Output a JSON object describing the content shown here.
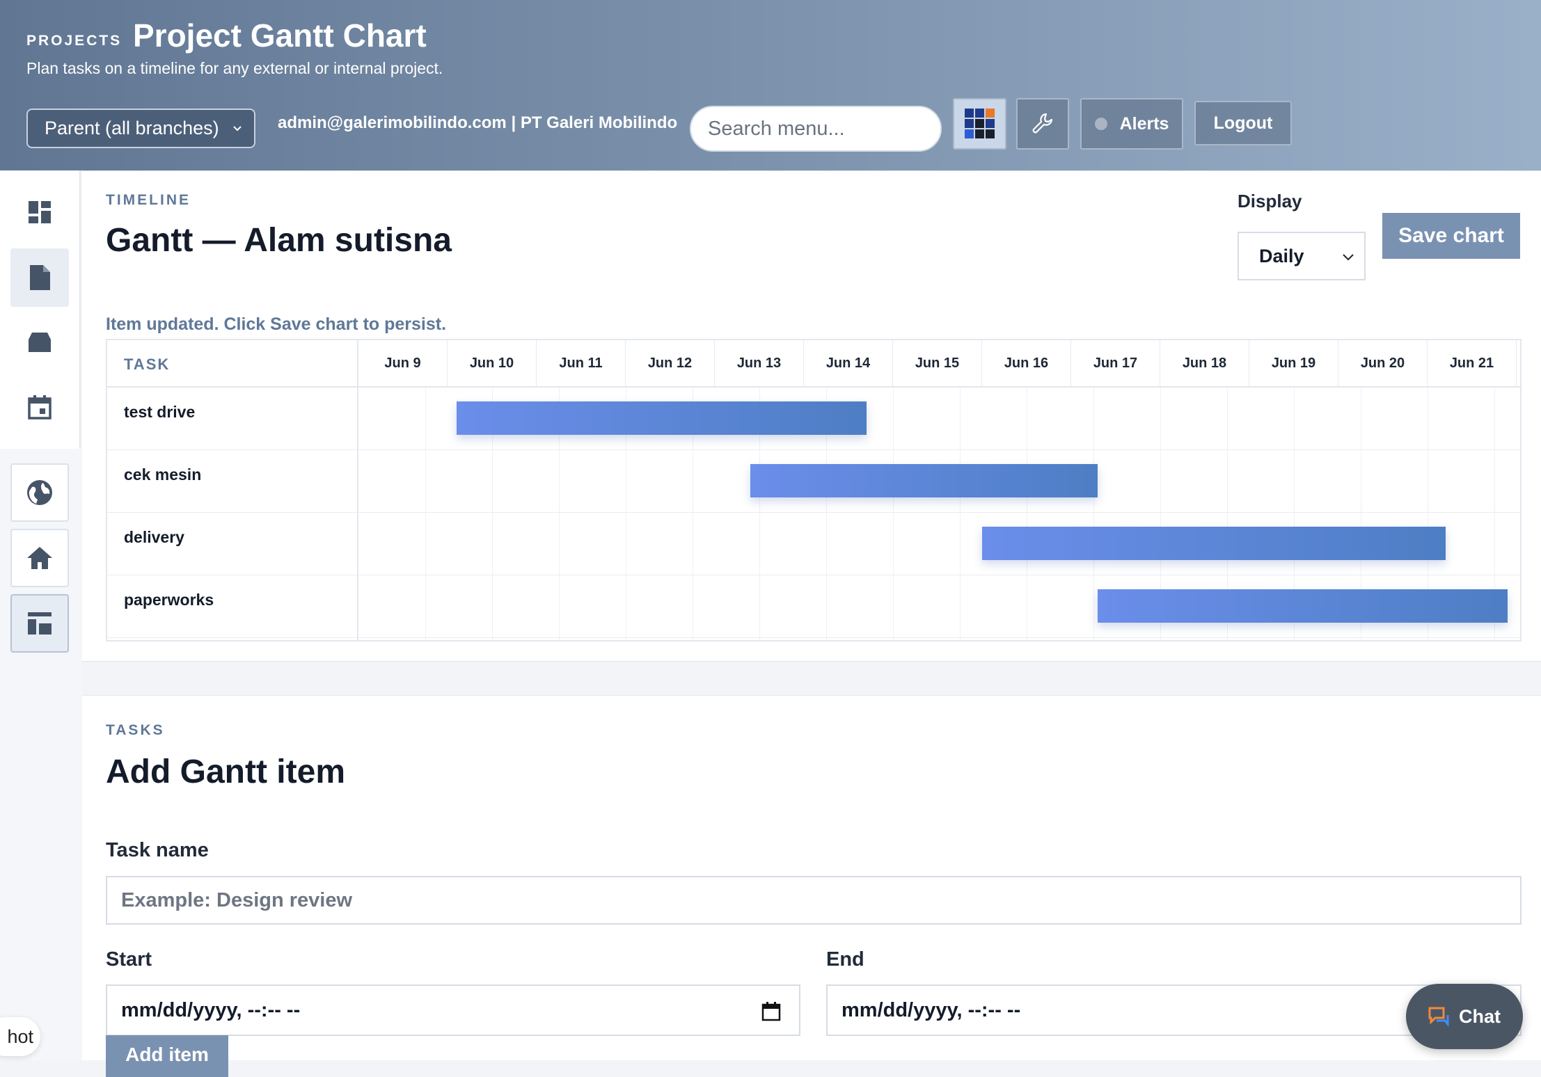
{
  "header": {
    "eyebrow": "PROJECTS",
    "title": "Project Gantt Chart",
    "subtitle": "Plan tasks on a timeline for any external or internal project.",
    "branch_select": "Parent (all branches)",
    "account": "admin@galerimobilindo.com | PT Galeri Mobilindo",
    "search_placeholder": "Search menu...",
    "alerts_label": "Alerts",
    "logout_label": "Logout"
  },
  "sidebar": {
    "items": [
      {
        "icon": "dashboard-icon"
      },
      {
        "icon": "document-icon",
        "active": true
      },
      {
        "icon": "inbox-icon"
      },
      {
        "icon": "calendar-icon"
      },
      {
        "icon": "globe-icon"
      },
      {
        "icon": "home-icon"
      },
      {
        "icon": "layout-icon",
        "active": true
      }
    ]
  },
  "timeline": {
    "kicker": "TIMELINE",
    "heading": "Gantt — Alam sutisna",
    "display_label": "Display",
    "display_value": "Daily",
    "save_label": "Save chart",
    "status": "Item updated. Click Save chart to persist.",
    "task_header": "TASK",
    "dates": [
      "Jun 9",
      "Jun 10",
      "Jun 11",
      "Jun 12",
      "Jun 13",
      "Jun 14",
      "Jun 15",
      "Jun 16",
      "Jun 17",
      "Jun 18",
      "Jun 19",
      "Jun 20",
      "Jun 21"
    ],
    "tasks": [
      {
        "name": "test drive",
        "start_day": 9.6,
        "end_day": 14.2
      },
      {
        "name": "cek mesin",
        "start_day": 12.9,
        "end_day": 16.8
      },
      {
        "name": "delivery",
        "start_day": 15.5,
        "end_day": 20.7
      },
      {
        "name": "paperworks",
        "start_day": 16.8,
        "end_day": 21.4
      }
    ]
  },
  "tasks_form": {
    "kicker": "TASKS",
    "heading": "Add Gantt item",
    "task_name_label": "Task name",
    "task_name_placeholder": "Example: Design review",
    "start_label": "Start",
    "start_value": "mm/dd/yyyy, --:-- --",
    "end_label": "End",
    "end_value": "mm/dd/yyyy, --:-- --",
    "add_label": "Add item"
  },
  "chat_label": "Chat",
  "corner_text": "hot",
  "colors": {
    "accent": "#7a92b2",
    "bar_start": "#6a8eea",
    "bar_end": "#4e7ec4",
    "header_start": "#607693",
    "header_end": "#9ab0c9"
  }
}
